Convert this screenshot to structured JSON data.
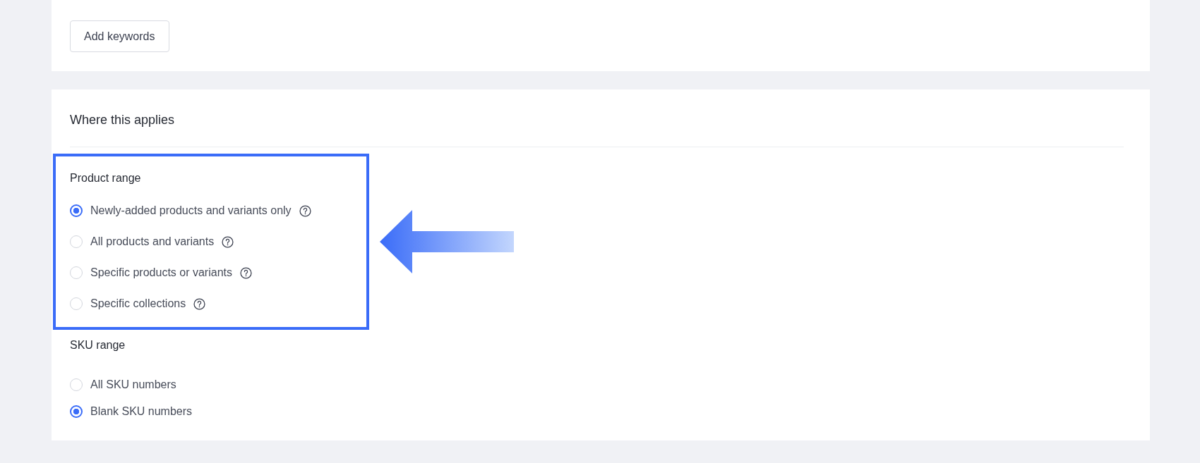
{
  "keywords_card": {
    "button": "Add keywords"
  },
  "where_this_applies": {
    "title": "Where this applies",
    "product_range": {
      "label": "Product range",
      "highlighted": true,
      "options": [
        {
          "label": "Newly-added products and variants only",
          "selected": true,
          "help": true
        },
        {
          "label": "All products and variants",
          "selected": false,
          "help": true
        },
        {
          "label": "Specific products or variants",
          "selected": false,
          "help": true
        },
        {
          "label": "Specific collections",
          "selected": false,
          "help": true
        }
      ]
    },
    "sku_range": {
      "label": "SKU range",
      "options": [
        {
          "label": "All SKU numbers",
          "selected": false
        },
        {
          "label": "Blank SKU numbers",
          "selected": true
        }
      ]
    }
  }
}
